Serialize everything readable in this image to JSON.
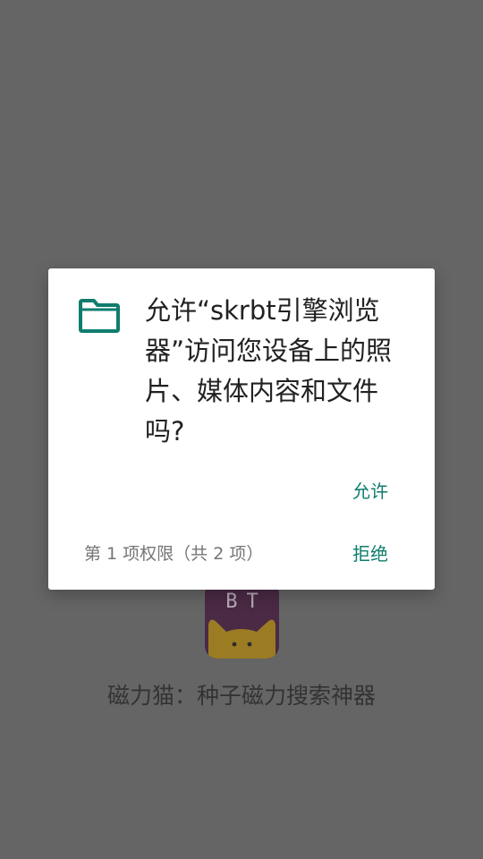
{
  "background_app": {
    "icon_text": "BT",
    "app_title": "磁力猫：种子磁力搜索神器"
  },
  "dialog": {
    "icon": "folder-icon",
    "message": "允许“skrbt引擎浏览器”访问您设备上的照片、媒体内容和文件吗?",
    "allow_label": "允许",
    "deny_label": "拒绝",
    "page_counter": "第 1 项权限（共 2 项）"
  },
  "colors": {
    "accent": "#0f7d6d",
    "scrim": "#656565",
    "dialog_bg": "#ffffff"
  }
}
